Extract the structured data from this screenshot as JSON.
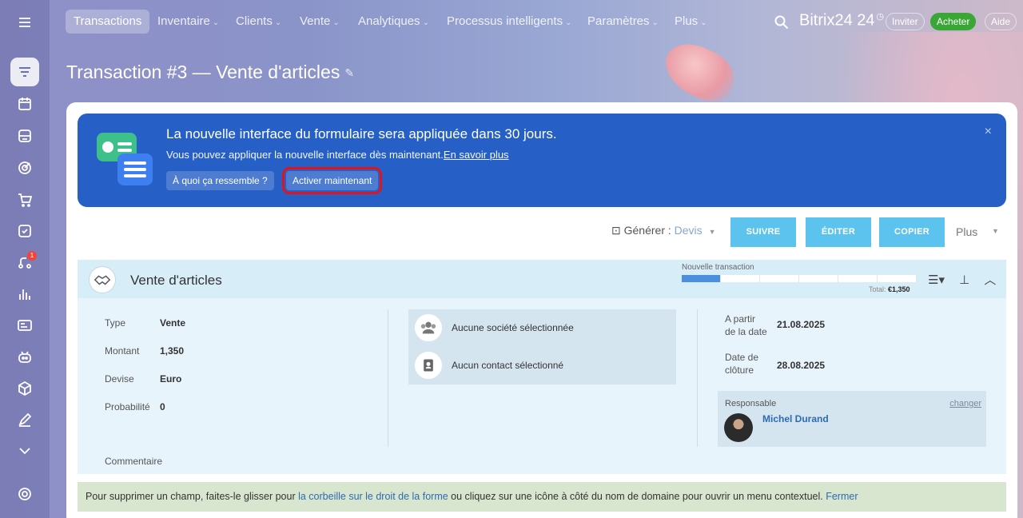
{
  "nav": {
    "items": [
      {
        "label": "Transactions",
        "active": true
      },
      {
        "label": "Inventaire"
      },
      {
        "label": "Clients"
      },
      {
        "label": "Vente"
      },
      {
        "label": "Analytiques"
      },
      {
        "label": "Processus intelligents"
      },
      {
        "label": "Paramètres"
      },
      {
        "label": "Plus"
      }
    ],
    "brand": "Bitrix24",
    "brand_suffix": "24",
    "invite": "Inviter",
    "buy": "Acheter",
    "help": "Aide"
  },
  "sidebar": {
    "icons": [
      "menu-icon",
      "funnel-icon",
      "calendar-icon",
      "inbox-icon",
      "target-icon",
      "cart-icon",
      "checkbox-icon",
      "automation-icon",
      "analytics-icon",
      "contact-card-icon",
      "robot-icon",
      "box-icon",
      "signature-icon",
      "expand-icon",
      "gear-icon"
    ],
    "badge": "1"
  },
  "page": {
    "title": "Transaction #3 — Vente d'articles"
  },
  "banner": {
    "title": "La nouvelle interface du formulaire sera appliquée dans 30 jours.",
    "subtitle": "Vous pouvez appliquer la nouvelle interface dès maintenant.",
    "link": "En savoir plus",
    "btn_preview": "À quoi ça ressemble ?",
    "btn_activate": "Activer maintenant",
    "close": "×"
  },
  "toolbar": {
    "generate_label": "Générer :",
    "generate_value": "Devis",
    "follow": "SUIVRE",
    "edit": "ÉDITER",
    "copy": "COPIER",
    "more": "Plus"
  },
  "section": {
    "title": "Vente d'articles",
    "stage_label": "Nouvelle transaction",
    "stage_segments_total": 6,
    "stage_segments_active": 1,
    "total_label": "Total:",
    "total_value": "€1,350"
  },
  "fields": {
    "type_label": "Type",
    "type_value": "Vente",
    "amount_label": "Montant",
    "amount_value": "1,350",
    "currency_label": "Devise",
    "currency_value": "Euro",
    "prob_label": "Probabilité",
    "prob_value": "0",
    "comment_label": "Commentaire"
  },
  "client": {
    "company": "Aucune société sélectionnée",
    "contact": "Aucun contact sélectionné"
  },
  "dates": {
    "start_label_1": "A partir",
    "start_label_2": "de la date",
    "start_value": "21.08.2025",
    "close_label_1": "Date de",
    "close_label_2": "clôture",
    "close_value": "28.08.2025"
  },
  "responsible": {
    "label": "Responsable",
    "change": "changer",
    "name": "Michel Durand"
  },
  "hint": {
    "text_before": "Pour supprimer un champ, faites-le glisser pour ",
    "link1": "la corbeille sur le droit de la forme",
    "text_after": " ou cliquez sur une icône à côté du nom de domaine pour ouvrir un menu contextuel. ",
    "close": "Fermer"
  }
}
